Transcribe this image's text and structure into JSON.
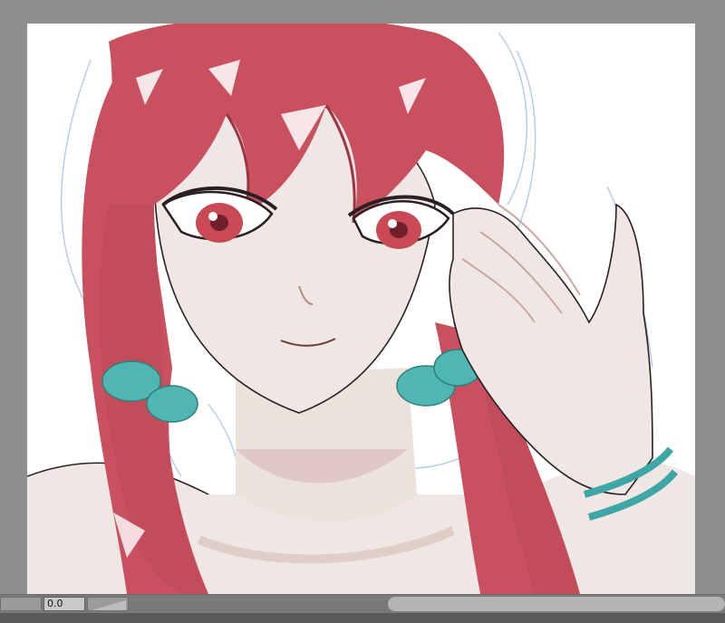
{
  "statusbar": {
    "value_field": "0.0"
  },
  "colors": {
    "workspace_bg": "#8e8e8e",
    "canvas_bg": "#ffffff",
    "hair": "#c9515f",
    "hair_shadow": "#9d3444",
    "scrunchie": "#4fb6b1",
    "bracelet": "#3fa6a6",
    "skin": "#efe7e3",
    "sketch_lines": "#a9c6ea"
  }
}
